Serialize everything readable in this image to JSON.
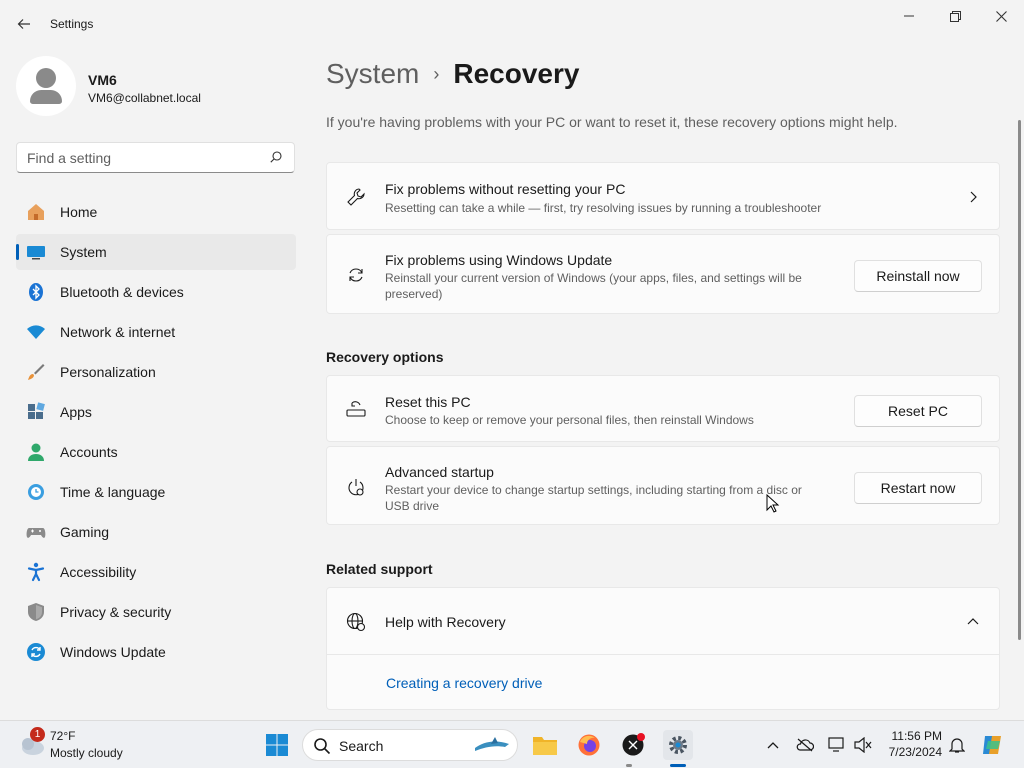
{
  "window": {
    "title": "Settings"
  },
  "profile": {
    "name": "VM6",
    "email": "VM6@collabnet.local"
  },
  "search": {
    "placeholder": "Find a setting"
  },
  "sidebar": {
    "items": [
      {
        "label": "Home",
        "icon": "home-icon"
      },
      {
        "label": "System",
        "icon": "system-icon",
        "active": true
      },
      {
        "label": "Bluetooth & devices",
        "icon": "bluetooth-icon"
      },
      {
        "label": "Network & internet",
        "icon": "wifi-icon"
      },
      {
        "label": "Personalization",
        "icon": "brush-icon"
      },
      {
        "label": "Apps",
        "icon": "apps-icon"
      },
      {
        "label": "Accounts",
        "icon": "accounts-icon"
      },
      {
        "label": "Time & language",
        "icon": "clock-globe-icon"
      },
      {
        "label": "Gaming",
        "icon": "gamepad-icon"
      },
      {
        "label": "Accessibility",
        "icon": "accessibility-icon"
      },
      {
        "label": "Privacy & security",
        "icon": "shield-icon"
      },
      {
        "label": "Windows Update",
        "icon": "update-icon"
      }
    ]
  },
  "main": {
    "breadcrumb_parent": "System",
    "breadcrumb_sep": "›",
    "page_title": "Recovery",
    "intro": "If you're having problems with your PC or want to reset it, these recovery options might help.",
    "cards": {
      "troubleshoot": {
        "title": "Fix problems without resetting your PC",
        "desc": "Resetting can take a while — first, try resolving issues by running a troubleshooter"
      },
      "windows_update": {
        "title": "Fix problems using Windows Update",
        "desc": "Reinstall your current version of Windows (your apps, files, and settings will be preserved)",
        "button": "Reinstall now"
      }
    },
    "recovery_options": {
      "heading": "Recovery options",
      "reset": {
        "title": "Reset this PC",
        "desc": "Choose to keep or remove your personal files, then reinstall Windows",
        "button": "Reset PC"
      },
      "advanced": {
        "title": "Advanced startup",
        "desc": "Restart your device to change startup settings, including starting from a disc or USB drive",
        "button": "Restart now"
      }
    },
    "related_support": {
      "heading": "Related support",
      "help_title": "Help with Recovery",
      "link": "Creating a recovery drive"
    }
  },
  "taskbar": {
    "weather_temp": "72°F",
    "weather_desc": "Mostly cloudy",
    "weather_badge": "1",
    "search_label": "Search",
    "time": "11:56 PM",
    "date": "7/23/2024"
  },
  "colors": {
    "accent": "#005fb8",
    "background": "#f3f3f3",
    "card": "#fbfbfb"
  }
}
